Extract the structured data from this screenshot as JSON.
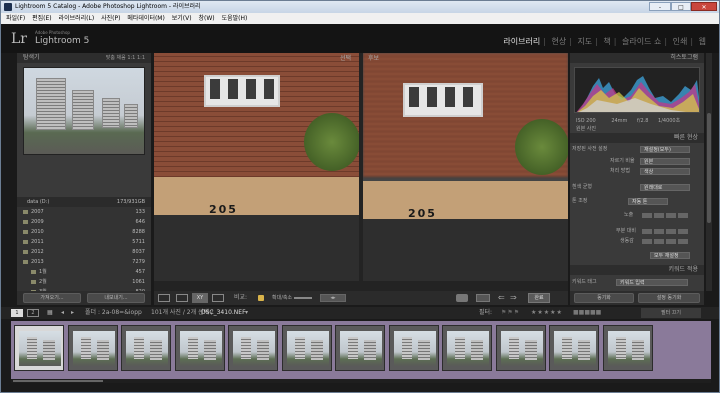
{
  "window": {
    "title": "Lightroom 5 Catalog - Adobe Photoshop Lightroom - 라이브러리",
    "controls": [
      "-",
      "□",
      "✕"
    ]
  },
  "menu": [
    "파일(F)",
    "편집(E)",
    "라이브러리(L)",
    "사진(P)",
    "메타데이터(M)",
    "보기(V)",
    "창(W)",
    "도움말(H)"
  ],
  "identity": {
    "logo": "Lr",
    "line1": "Adobe Photoshop",
    "line2": "Lightroom 5"
  },
  "modules": [
    "라이브러리",
    "현상",
    "지도",
    "책",
    "슬라이드 쇼",
    "인쇄",
    "웹"
  ],
  "active_module": "라이브러리",
  "left": {
    "navigator": {
      "title": "탐색기",
      "modes": [
        "맞춤",
        "채움",
        "1:1",
        "1:1"
      ]
    },
    "catalog": {
      "drive": "data (D:)",
      "drive_info": "173/931GB",
      "folders": [
        {
          "name": "2007",
          "count": "133"
        },
        {
          "name": "2009",
          "count": "646"
        },
        {
          "name": "2010",
          "count": "8288"
        },
        {
          "name": "2011",
          "count": "5711"
        },
        {
          "name": "2012",
          "count": "8037"
        },
        {
          "name": "2013",
          "count": "7279"
        },
        {
          "name": "1월",
          "count": "457"
        },
        {
          "name": "2월",
          "count": "1061"
        },
        {
          "name": "3월",
          "count": "820"
        }
      ]
    },
    "buttons": {
      "import": "가져오기...",
      "export": "내보내기..."
    }
  },
  "compare": {
    "select_label": "선택",
    "candidate_label": "후보",
    "number_text": "205"
  },
  "compare_toolbar": {
    "compare_label": "비교:",
    "zoom_label": "확대/축소",
    "done": "완료"
  },
  "right": {
    "histogram": {
      "title": "히스토그램",
      "iso": "ISO 200",
      "focal": "24mm",
      "aperture": "f/2.8",
      "shutter": "1/4000초",
      "original": "원본 사진"
    },
    "quick_develop": {
      "title": "빠른 현상",
      "preset_label": "저장된 사전 설정",
      "preset_value": "재설정(모두)",
      "crop_label": "자르기 비율",
      "crop_value": "원본",
      "treat_label": "처리 방법",
      "treat_value": "색상",
      "wb_label": "흰색 균형",
      "wb_value": "원래대로",
      "tone_label": "톤 조정",
      "tone_value": "자동 톤",
      "exposure": "노출",
      "clarity": "부분 대비",
      "vibrance": "생동감",
      "reset": "모두 재설정"
    },
    "keywording": {
      "title": "키워드 적용",
      "tag_label": "키워드 태그",
      "tag_value": "키워드 입력"
    },
    "buttons": {
      "sync": "동기화",
      "sync_settings": "설정 동기화"
    }
  },
  "filmstrip": {
    "source": "폴더 : 2a-08=&iopp",
    "info": "101개 사진 / 2개 선택 /",
    "filename": "DSC_3410.NEF",
    "filter_label": "필터:",
    "filter_off": "필터 끄기",
    "thumb_count": 12
  }
}
